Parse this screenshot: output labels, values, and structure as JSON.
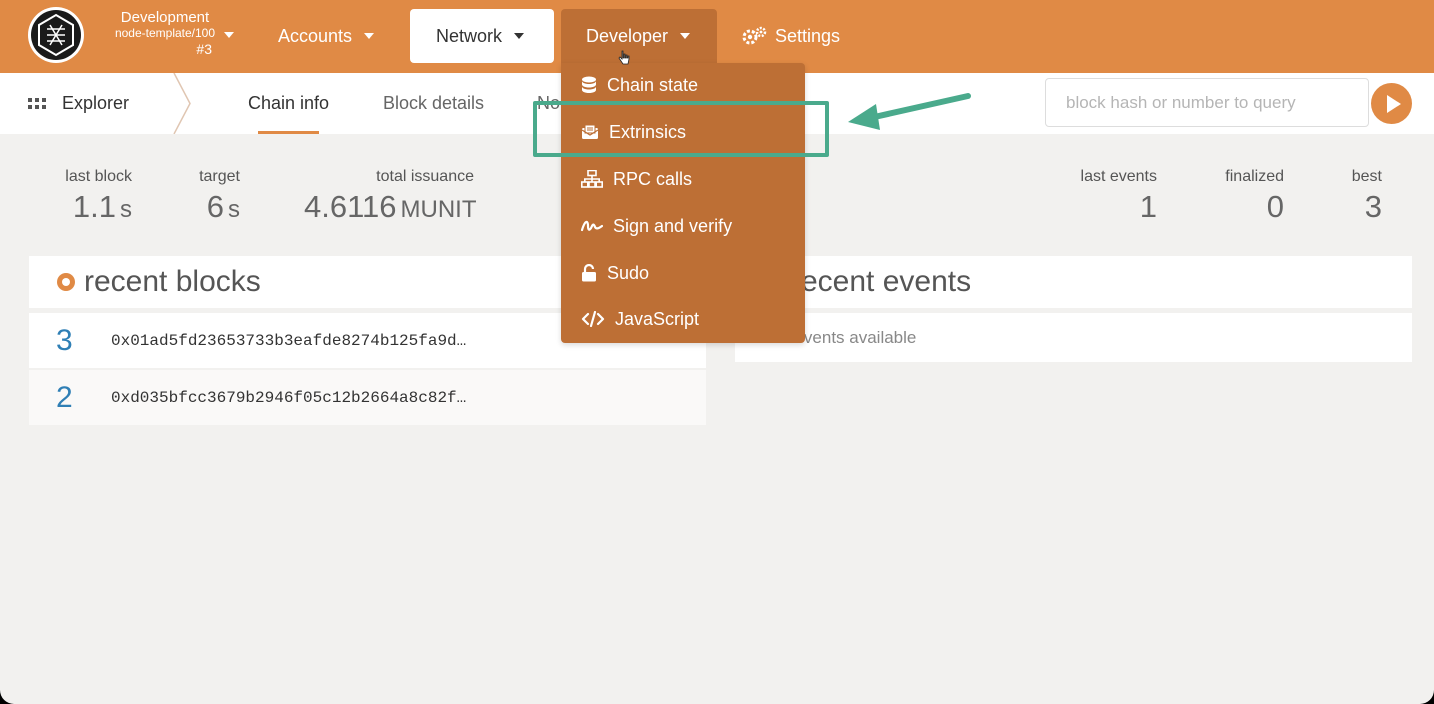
{
  "topbar": {
    "chain_name": "Development",
    "chain_runtime": "node-template/100",
    "chain_block": "#3",
    "nav": {
      "accounts": "Accounts",
      "network": "Network",
      "developer": "Developer",
      "settings": "Settings"
    },
    "accent_color": "#e08a45"
  },
  "subnav": {
    "section": "Explorer",
    "tabs": [
      "Chain info",
      "Block details",
      "No"
    ],
    "active_tab": "Chain info",
    "search_placeholder": "block hash or number to query"
  },
  "stats": {
    "last_block": {
      "label": "last block",
      "value": "1.1",
      "unit": "s"
    },
    "target": {
      "label": "target",
      "value": "6",
      "unit": "s"
    },
    "total_issuance": {
      "label": "total issuance",
      "value": "4.6116",
      "unit": "MUNIT"
    },
    "last_events": {
      "label": "last events",
      "value": "1"
    },
    "finalized": {
      "label": "finalized",
      "value": "0"
    },
    "best": {
      "label": "best",
      "value": "3"
    }
  },
  "recent_blocks": {
    "title": "recent blocks",
    "rows": [
      {
        "number": "3",
        "hash": "0x01ad5fd23653733b3eafde8274b125fa9d…"
      },
      {
        "number": "2",
        "hash": "0xd035bfcc3679b2946f05c12b2664a8c82f…"
      }
    ]
  },
  "recent_events": {
    "title": "recent events",
    "empty_text": "No events available"
  },
  "developer_menu": {
    "items": [
      "Chain state",
      "Extrinsics",
      "RPC calls",
      "Sign and verify",
      "Sudo",
      "JavaScript"
    ],
    "icons": [
      "database-icon",
      "envelope-icon",
      "sitemap-icon",
      "signature-icon",
      "unlock-icon",
      "code-icon"
    ],
    "highlighted": "Extrinsics"
  },
  "annotation": {
    "color": "#4aaa8c"
  }
}
